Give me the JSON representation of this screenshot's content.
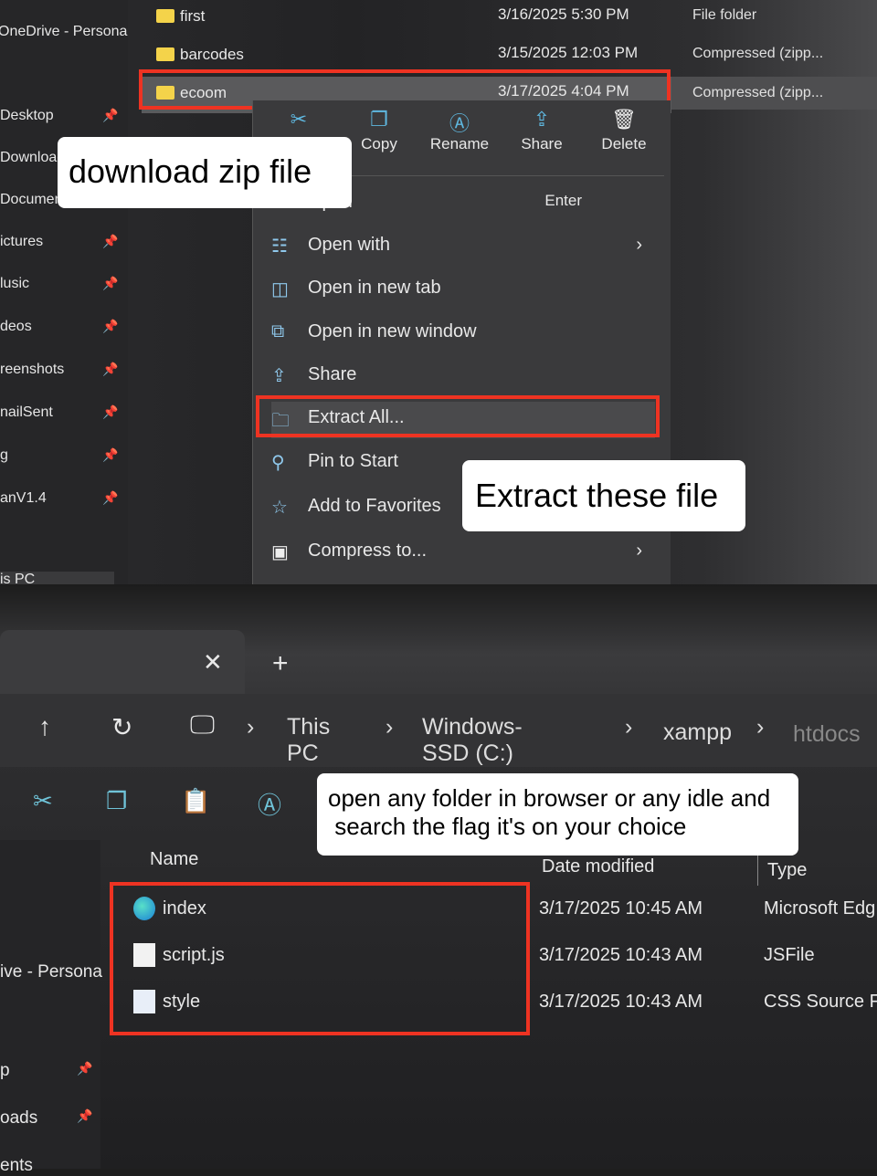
{
  "top": {
    "sidebar": [
      {
        "label": "OneDrive - Persona",
        "pinned": false
      },
      {
        "label": "Desktop",
        "pinned": true
      },
      {
        "label": "Downloads",
        "pinned": true
      },
      {
        "label": "Documents",
        "pinned": true
      },
      {
        "label": "ictures",
        "pinned": true
      },
      {
        "label": "lusic",
        "pinned": true
      },
      {
        "label": "deos",
        "pinned": true
      },
      {
        "label": "reenshots",
        "pinned": true
      },
      {
        "label": "nailSent",
        "pinned": true
      },
      {
        "label": "g",
        "pinned": true
      },
      {
        "label": "anV1.4",
        "pinned": true
      },
      {
        "label": "is PC",
        "pinned": false
      }
    ],
    "files": [
      {
        "name": "first",
        "date": "3/16/2025 5:30 PM",
        "type": "File folder"
      },
      {
        "name": "barcodes",
        "date": "3/15/2025 12:03 PM",
        "type": "Compressed (zipp..."
      },
      {
        "name": "ecoom",
        "date": "3/17/2025 4:04 PM",
        "type": "Compressed (zipp..."
      }
    ],
    "context_menu": {
      "quick_actions": [
        {
          "label": "Cut",
          "icon": "scissors-icon"
        },
        {
          "label": "Copy",
          "icon": "copy-icon"
        },
        {
          "label": "Rename",
          "icon": "rename-icon"
        },
        {
          "label": "Share",
          "icon": "share-icon"
        },
        {
          "label": "Delete",
          "icon": "trash-icon"
        }
      ],
      "items": [
        {
          "label": "Open",
          "shortcut": "Enter",
          "icon": "open-icon"
        },
        {
          "label": "Open with",
          "submenu": true,
          "icon": "open-with-icon"
        },
        {
          "label": "Open in new tab",
          "icon": "new-tab-icon"
        },
        {
          "label": "Open in new window",
          "icon": "new-window-icon"
        },
        {
          "label": "Share",
          "icon": "share-icon"
        },
        {
          "label": "Extract All...",
          "icon": "extract-icon"
        },
        {
          "label": "Pin to Start",
          "icon": "pin-icon"
        },
        {
          "label": "Add to Favorites",
          "icon": "star-icon"
        },
        {
          "label": "Compress to...",
          "submenu": true,
          "icon": "compress-icon"
        }
      ]
    },
    "callout_download": "download zip file",
    "callout_extract": "Extract these file"
  },
  "bottom": {
    "breadcrumb": [
      "This PC",
      "Windows-SSD (C:)",
      "xampp",
      "htdocs"
    ],
    "columns": {
      "name": "Name",
      "date": "Date modified",
      "type": "Type"
    },
    "files": [
      {
        "name": "index",
        "date": "3/17/2025 10:45 AM",
        "type": "Microsoft Edg"
      },
      {
        "name": "script.js",
        "date": "3/17/2025 10:43 AM",
        "type": "JSFile"
      },
      {
        "name": "style",
        "date": "3/17/2025 10:43 AM",
        "type": "CSS Source Fil"
      }
    ],
    "sidebar": [
      {
        "label": "ive - Persona",
        "pinned": false
      },
      {
        "label": "p",
        "pinned": true
      },
      {
        "label": "oads",
        "pinned": true
      },
      {
        "label": "ents",
        "pinned": true
      }
    ],
    "callout_line1": "open any folder in browser or any idle and",
    "callout_line2": " search the flag it's on your choice"
  },
  "colors": {
    "highlight": "#ee3322",
    "accent": "#5fb8e0",
    "folder": "#f4d34a"
  }
}
